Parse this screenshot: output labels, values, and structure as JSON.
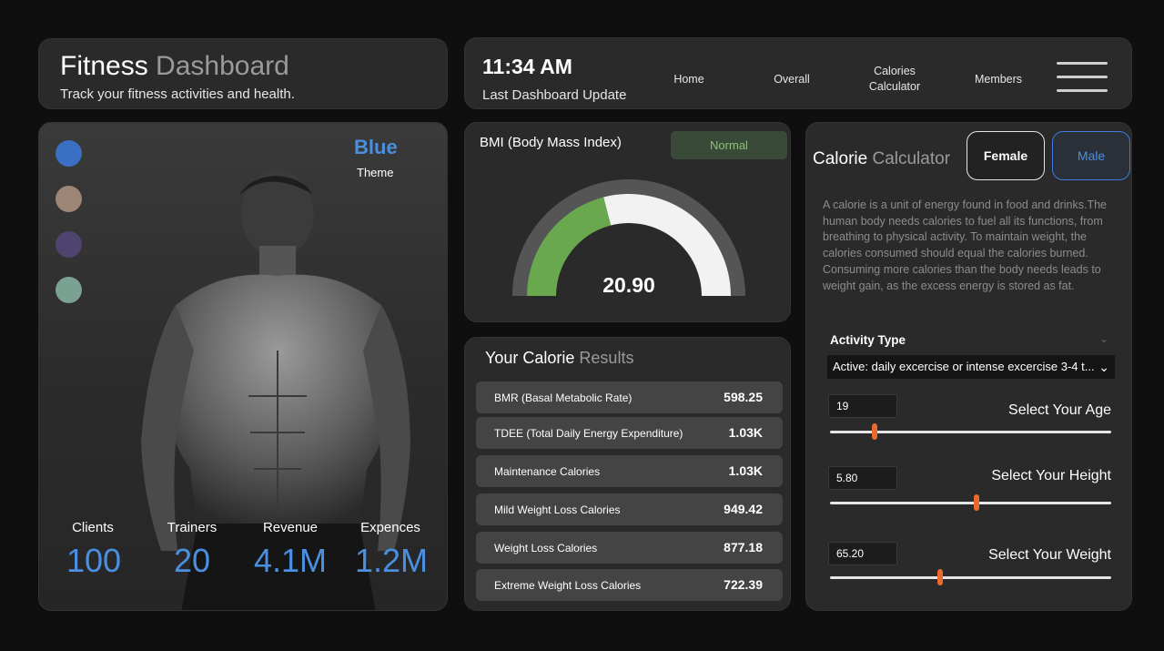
{
  "title": {
    "primary": "Fitness",
    "secondary": "Dashboard",
    "subtitle": "Track your fitness activities and health."
  },
  "header": {
    "time": "11:34 AM",
    "last_update": "Last Dashboard Update",
    "nav": [
      "Home",
      "Overall",
      "Calories Calculator",
      "Members"
    ],
    "menu_icon": "hamburger-menu-icon"
  },
  "theme": {
    "name": "Blue",
    "label": "Theme",
    "swatches": [
      "#3a6fc4",
      "#9e8677",
      "#4f4470",
      "#7aa192"
    ]
  },
  "stats": [
    {
      "label": "Clients",
      "value": "100"
    },
    {
      "label": "Trainers",
      "value": "20"
    },
    {
      "label": "Revenue",
      "value": "4.1M"
    },
    {
      "label": "Expences",
      "value": "1.2M"
    }
  ],
  "bmi": {
    "title": "BMI (Body Mass Index)",
    "status": "Normal",
    "value": "20.90",
    "gauge_fraction": 0.42,
    "colors": {
      "fill": "#6aa84f",
      "rest": "#f2f2f2",
      "track": "#555555"
    }
  },
  "results": {
    "title_primary": "Your Calorie",
    "title_secondary": "Results",
    "rows": [
      {
        "label": "BMR (Basal Metabolic Rate)",
        "value": "598.25"
      },
      {
        "label": "TDEE (Total Daily Energy Expenditure)",
        "value": "1.03K"
      },
      {
        "label": "Maintenance Calories",
        "value": "1.03K"
      },
      {
        "label": "Mild Weight Loss Calories",
        "value": "949.42"
      },
      {
        "label": "Weight Loss Calories",
        "value": "877.18"
      },
      {
        "label": "Extreme Weight Loss Calories",
        "value": "722.39"
      }
    ]
  },
  "calculator": {
    "title_primary": "Calorie",
    "title_secondary": "Calculator",
    "female_label": "Female",
    "male_label": "Male",
    "description": "A calorie is a unit of energy found in food and drinks.The human body needs calories to fuel all its functions, from breathing to physical activity. To maintain weight, the calories consumed should equal the calories burned. Consuming more calories than the body needs leads to weight gain, as the excess energy is stored as fat.",
    "activity_label": "Activity Type",
    "activity_value": "Active: daily excercise or intense excercise 3-4 t...",
    "sliders": [
      {
        "label": "Select Your Age",
        "value": "19",
        "fraction": 0.16
      },
      {
        "label": "Select Your Height",
        "value": "5.80",
        "fraction": 0.52
      },
      {
        "label": "Select Your Weight",
        "value": "65.20",
        "fraction": 0.39
      }
    ],
    "accent": "#e86a2c"
  }
}
